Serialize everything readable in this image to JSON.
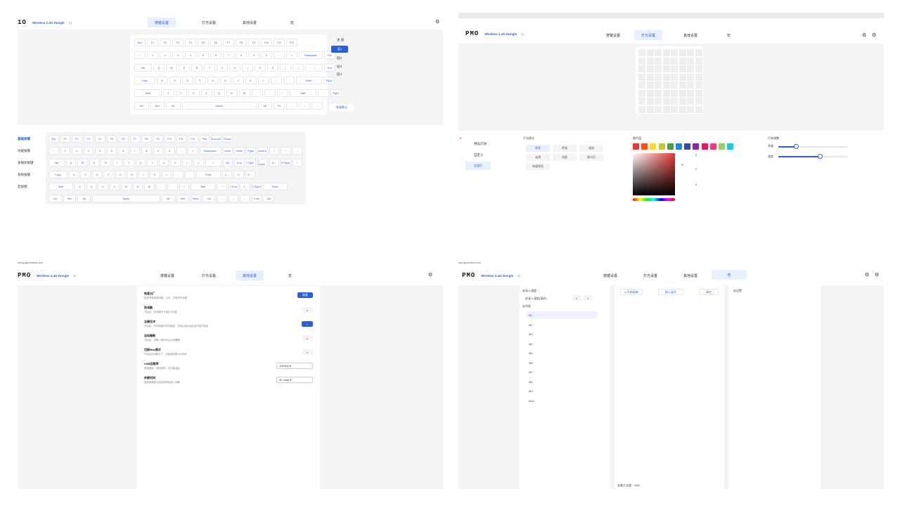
{
  "accent": "#2b5fd9",
  "q1": {
    "logo": "1O",
    "device": "Wireless 2.4G Dongle",
    "ci": "CI",
    "tabs": [
      "按键设置",
      "灯光设置",
      "其他设置",
      "宏"
    ],
    "layers": [
      "主 层",
      "层1",
      "层2",
      "层3",
      "层4"
    ],
    "reset": "恢复默认",
    "categories": [
      "基础按键",
      "功能按键",
      "多媒体按键",
      "系统按键",
      "宏按键"
    ],
    "kb_rows": [
      [
        "Esc",
        "F1",
        "F2",
        "F3",
        "F4",
        "F5",
        "F6",
        "F7",
        "F8",
        "F9",
        "F10",
        "F11",
        "F12"
      ],
      [
        "~",
        "1",
        "2",
        "3",
        "4",
        "5",
        "6",
        "7",
        "8",
        "9",
        "0",
        "-",
        "=",
        "Backspace",
        "Del"
      ],
      [
        "Tab",
        "Q",
        "W",
        "E",
        "R",
        "T",
        "Y",
        "U",
        "I",
        "O",
        "P",
        "[",
        "]",
        "\\",
        "End"
      ],
      [
        "Caps",
        "A",
        "S",
        "D",
        "F",
        "G",
        "H",
        "J",
        "K",
        "L",
        ";",
        "'",
        "Enter",
        "PgUp"
      ],
      [
        "Shift",
        "Z",
        "X",
        "C",
        "V",
        "B",
        "N",
        "M",
        ",",
        ".",
        "/",
        "Shift",
        "↑",
        "PgDn"
      ],
      [
        "Ctrl",
        "Win",
        "Alt",
        "Space",
        "Alt",
        "Fn",
        "←",
        "↓",
        "→"
      ]
    ],
    "bottom_rows": [
      [
        "Esc",
        "F1",
        "F2",
        "F3",
        "F4",
        "F5",
        "F6",
        "F7",
        "F8",
        "F9",
        "F10",
        "F11",
        "F12",
        "Prnt",
        "ScrLock",
        "Pause"
      ],
      [
        "~",
        "1",
        "2",
        "3",
        "4",
        "5",
        "6",
        "7",
        "8",
        "9",
        "0",
        "-",
        "=",
        "Backspace",
        "Insert",
        "Home",
        "PgUp",
        "NumLk",
        "/",
        "*",
        "-"
      ],
      [
        "Tab",
        "Q",
        "W",
        "E",
        "R",
        "T",
        "Y",
        "U",
        "I",
        "O",
        "P",
        "[",
        "]",
        "\\",
        "Del",
        "End",
        "PgDn",
        "7 Home",
        "8 ↑",
        "9 PgUp",
        "+"
      ],
      [
        "Caps",
        "A",
        "S",
        "D",
        "F",
        "G",
        "H",
        "J",
        "K",
        "L",
        ";",
        "'",
        "Enter",
        "4 ←",
        "5",
        "6 →"
      ],
      [
        "Shift",
        "Z",
        "X",
        "C",
        "V",
        "B",
        "N",
        "M",
        ",",
        ".",
        "/",
        "Shift",
        "↑",
        "1 End",
        "2 ↓",
        "3 PgDn",
        "Enter"
      ],
      [
        "Ctrl",
        "Win",
        "Alt",
        "Space",
        "Alt",
        "Win",
        "Menu",
        "Ctrl",
        "←",
        "↓",
        "→",
        "0 Ins",
        ". Del"
      ]
    ]
  },
  "q2": {
    "logo": "PMO",
    "device": "Wireless 2.4G Dongle",
    "ci": "CI",
    "tabs": [
      "按键设置",
      "灯光设置",
      "其他设置",
      "宏"
    ],
    "left_menu": [
      "预设灯效",
      "自定义",
      "全部灯"
    ],
    "effect_title": "灯光模式",
    "effects": [
      "常亮",
      "呼吸",
      "波浪",
      "涟漪",
      "流星",
      "跑马灯",
      "单键常亮"
    ],
    "color_title": "颜色盘",
    "colors": [
      "#e53935",
      "#f4511e",
      "#fdd835",
      "#c0ca33",
      "#43a047",
      "#1e88e5",
      "#3949ab",
      "#8e24aa",
      "#d81b60",
      "#ec407a",
      "#9ccc65",
      "#26c6da"
    ],
    "picker": {
      "r": "R",
      "g": "G",
      "b": "B",
      "rv": "0",
      "gv": "0",
      "bv": "0"
    },
    "adjust_title": "灯效调整",
    "brightness_label": "亮度",
    "speed_label": "速度",
    "brightness": 0.25,
    "speed": 0.6
  },
  "q3": {
    "url": "strong.lgmwhiteok.com",
    "logo": "PMO",
    "device": "Wireless 2.4G Dongle",
    "ci": "CI",
    "tabs": [
      "按键设置",
      "灯光设置",
      "其他设置",
      "宏"
    ],
    "settings": [
      {
        "title": "恢复出厂",
        "desc": "恢复所有按键设置、灯光、宏等所有设置",
        "ctl": "恢复"
      },
      {
        "title": "防误触",
        "desc": "开启后，游戏模式下锁定Win键",
        "ctl": "×"
      },
      {
        "title": "全键无冲",
        "desc": "开启后，所有按键可同时触发，关闭后部分组合键可能不响应",
        "ctl": "on"
      },
      {
        "title": "自动睡眠",
        "desc": "开启后，闲置一段时间后自动睡眠",
        "ctl": "×"
      },
      {
        "title": "切换Mac模式",
        "desc": "开启后Mac模式下，功能键适配Mac系统",
        "ctl": "×"
      },
      {
        "title": "USB回报率",
        "desc": "数值越高，响应越快，但功耗越高",
        "ctl": "1000Hz"
      },
      {
        "title": "休眠时间",
        "desc": "键盘闲置超过设定时间后进入休眠",
        "ctl": "30 mins"
      }
    ]
  },
  "q4": {
    "url": "fmp.lgmwhiteok.com",
    "logo": "PMO",
    "device": "Wireless 2.4G Dongle",
    "ci": "CI",
    "tabs": [
      "按键设置",
      "灯光设置",
      "其他设置",
      "宏"
    ],
    "list_title": "宏录入速度",
    "speed_label": "宏录入速度(毫秒)",
    "list_sub": "宏列表",
    "macros": [
      "M1",
      "M2",
      "M3",
      "M4",
      "M5",
      "M6",
      "M7",
      "M8",
      "M9",
      "M10"
    ],
    "rec_buttons": [
      "开始录制",
      "插入延时",
      "清空"
    ],
    "footer": "宏最大长度：0/80",
    "right_title": "宏设置"
  }
}
